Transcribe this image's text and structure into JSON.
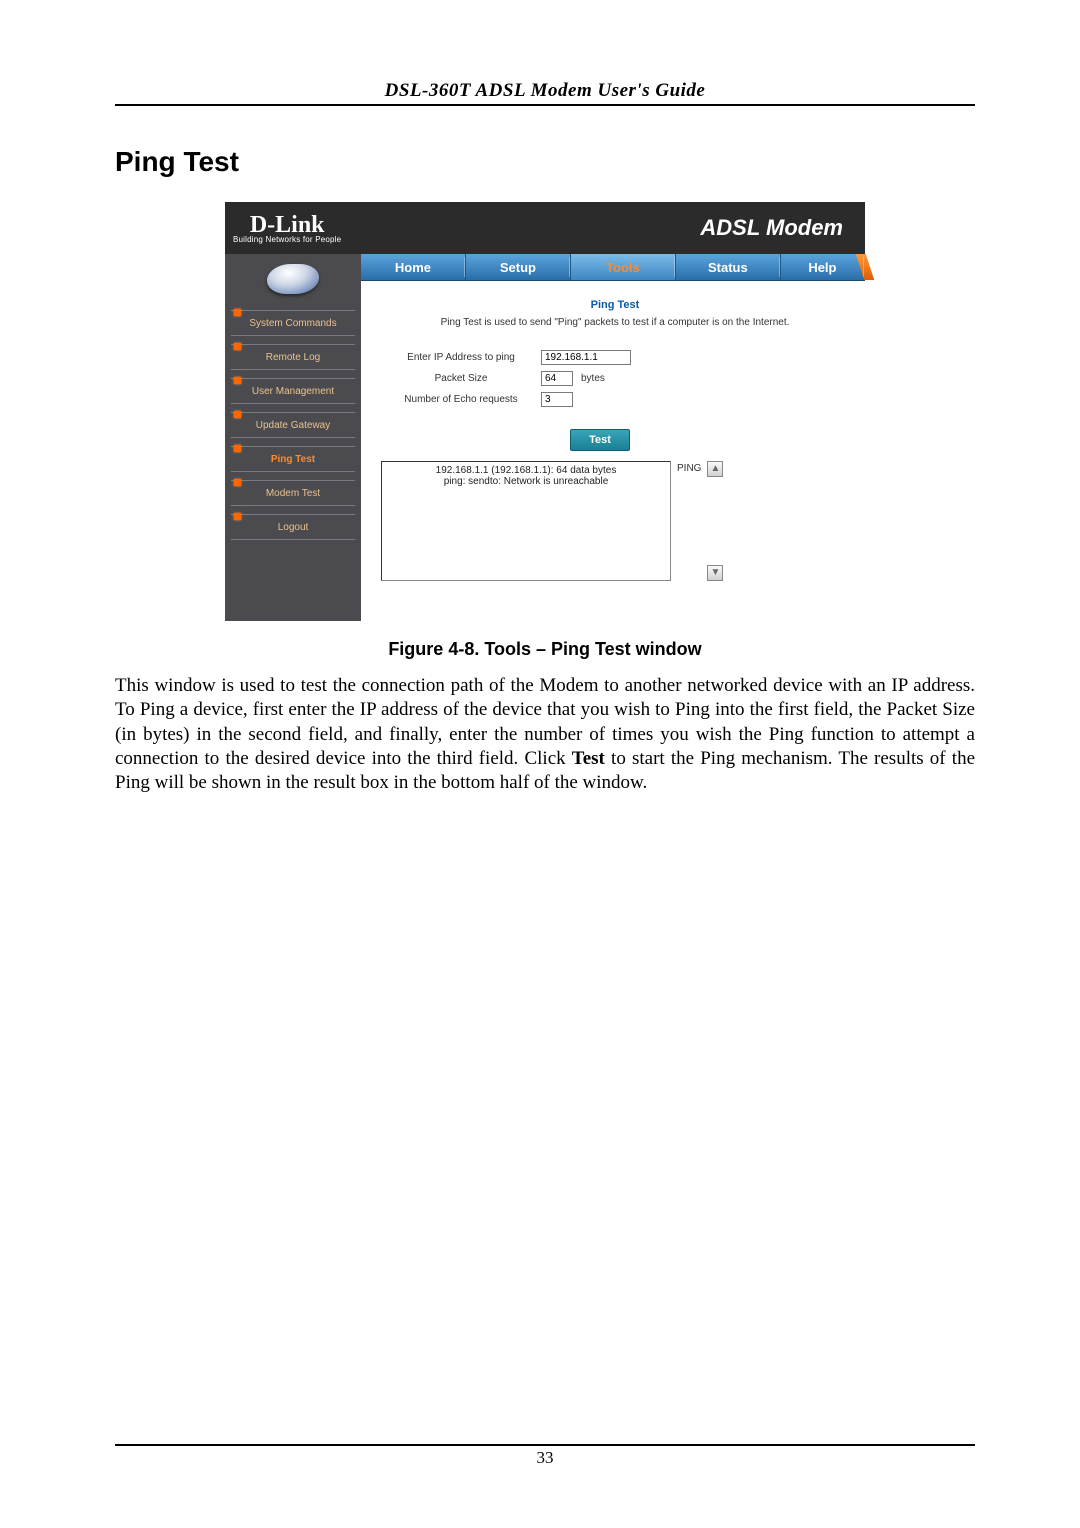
{
  "doc": {
    "running_head": "DSL-360T ADSL Modem User's Guide",
    "section_title": "Ping Test",
    "figure_caption": "Figure 4-8. Tools – Ping Test window",
    "body_html": "This window is used to test the connection path of the Modem to another networked device with an IP address. To Ping a device, first enter the IP address of the device that you wish to Ping into the first field, the Packet Size (in bytes) in the second field, and finally, enter the number of times you wish the Ping function to attempt a connection to the desired device into the third field. Click ",
    "body_bold": "Test",
    "body_tail": " to start the Ping mechanism. The results of the Ping will be shown in the result box in the bottom half of the window.",
    "page_number": "33"
  },
  "shot": {
    "brand": "D-Link",
    "brand_tag": "Building Networks for People",
    "product_title": "ADSL Modem",
    "tabs": {
      "home": "Home",
      "setup": "Setup",
      "tools": "Tools",
      "status": "Status",
      "help": "Help"
    },
    "sidebar": {
      "items": [
        {
          "label": "System Commands"
        },
        {
          "label": "Remote Log"
        },
        {
          "label": "User Management"
        },
        {
          "label": "Update Gateway"
        },
        {
          "label": "Ping Test"
        },
        {
          "label": "Modem Test"
        },
        {
          "label": "Logout"
        }
      ]
    },
    "panel": {
      "title": "Ping Test",
      "desc": "Ping Test is used to send \"Ping\" packets to test if a computer is on the Internet.",
      "ip_label": "Enter IP Address to ping",
      "ip_value": "192.168.1.1",
      "size_label": "Packet Size",
      "size_value": "64",
      "size_unit": "bytes",
      "echo_label": "Number of Echo requests",
      "echo_value": "3",
      "test_btn": "Test",
      "result_label": "PING",
      "result_text": "192.168.1.1 (192.168.1.1): 64 data bytes\nping: sendto: Network is unreachable"
    }
  }
}
